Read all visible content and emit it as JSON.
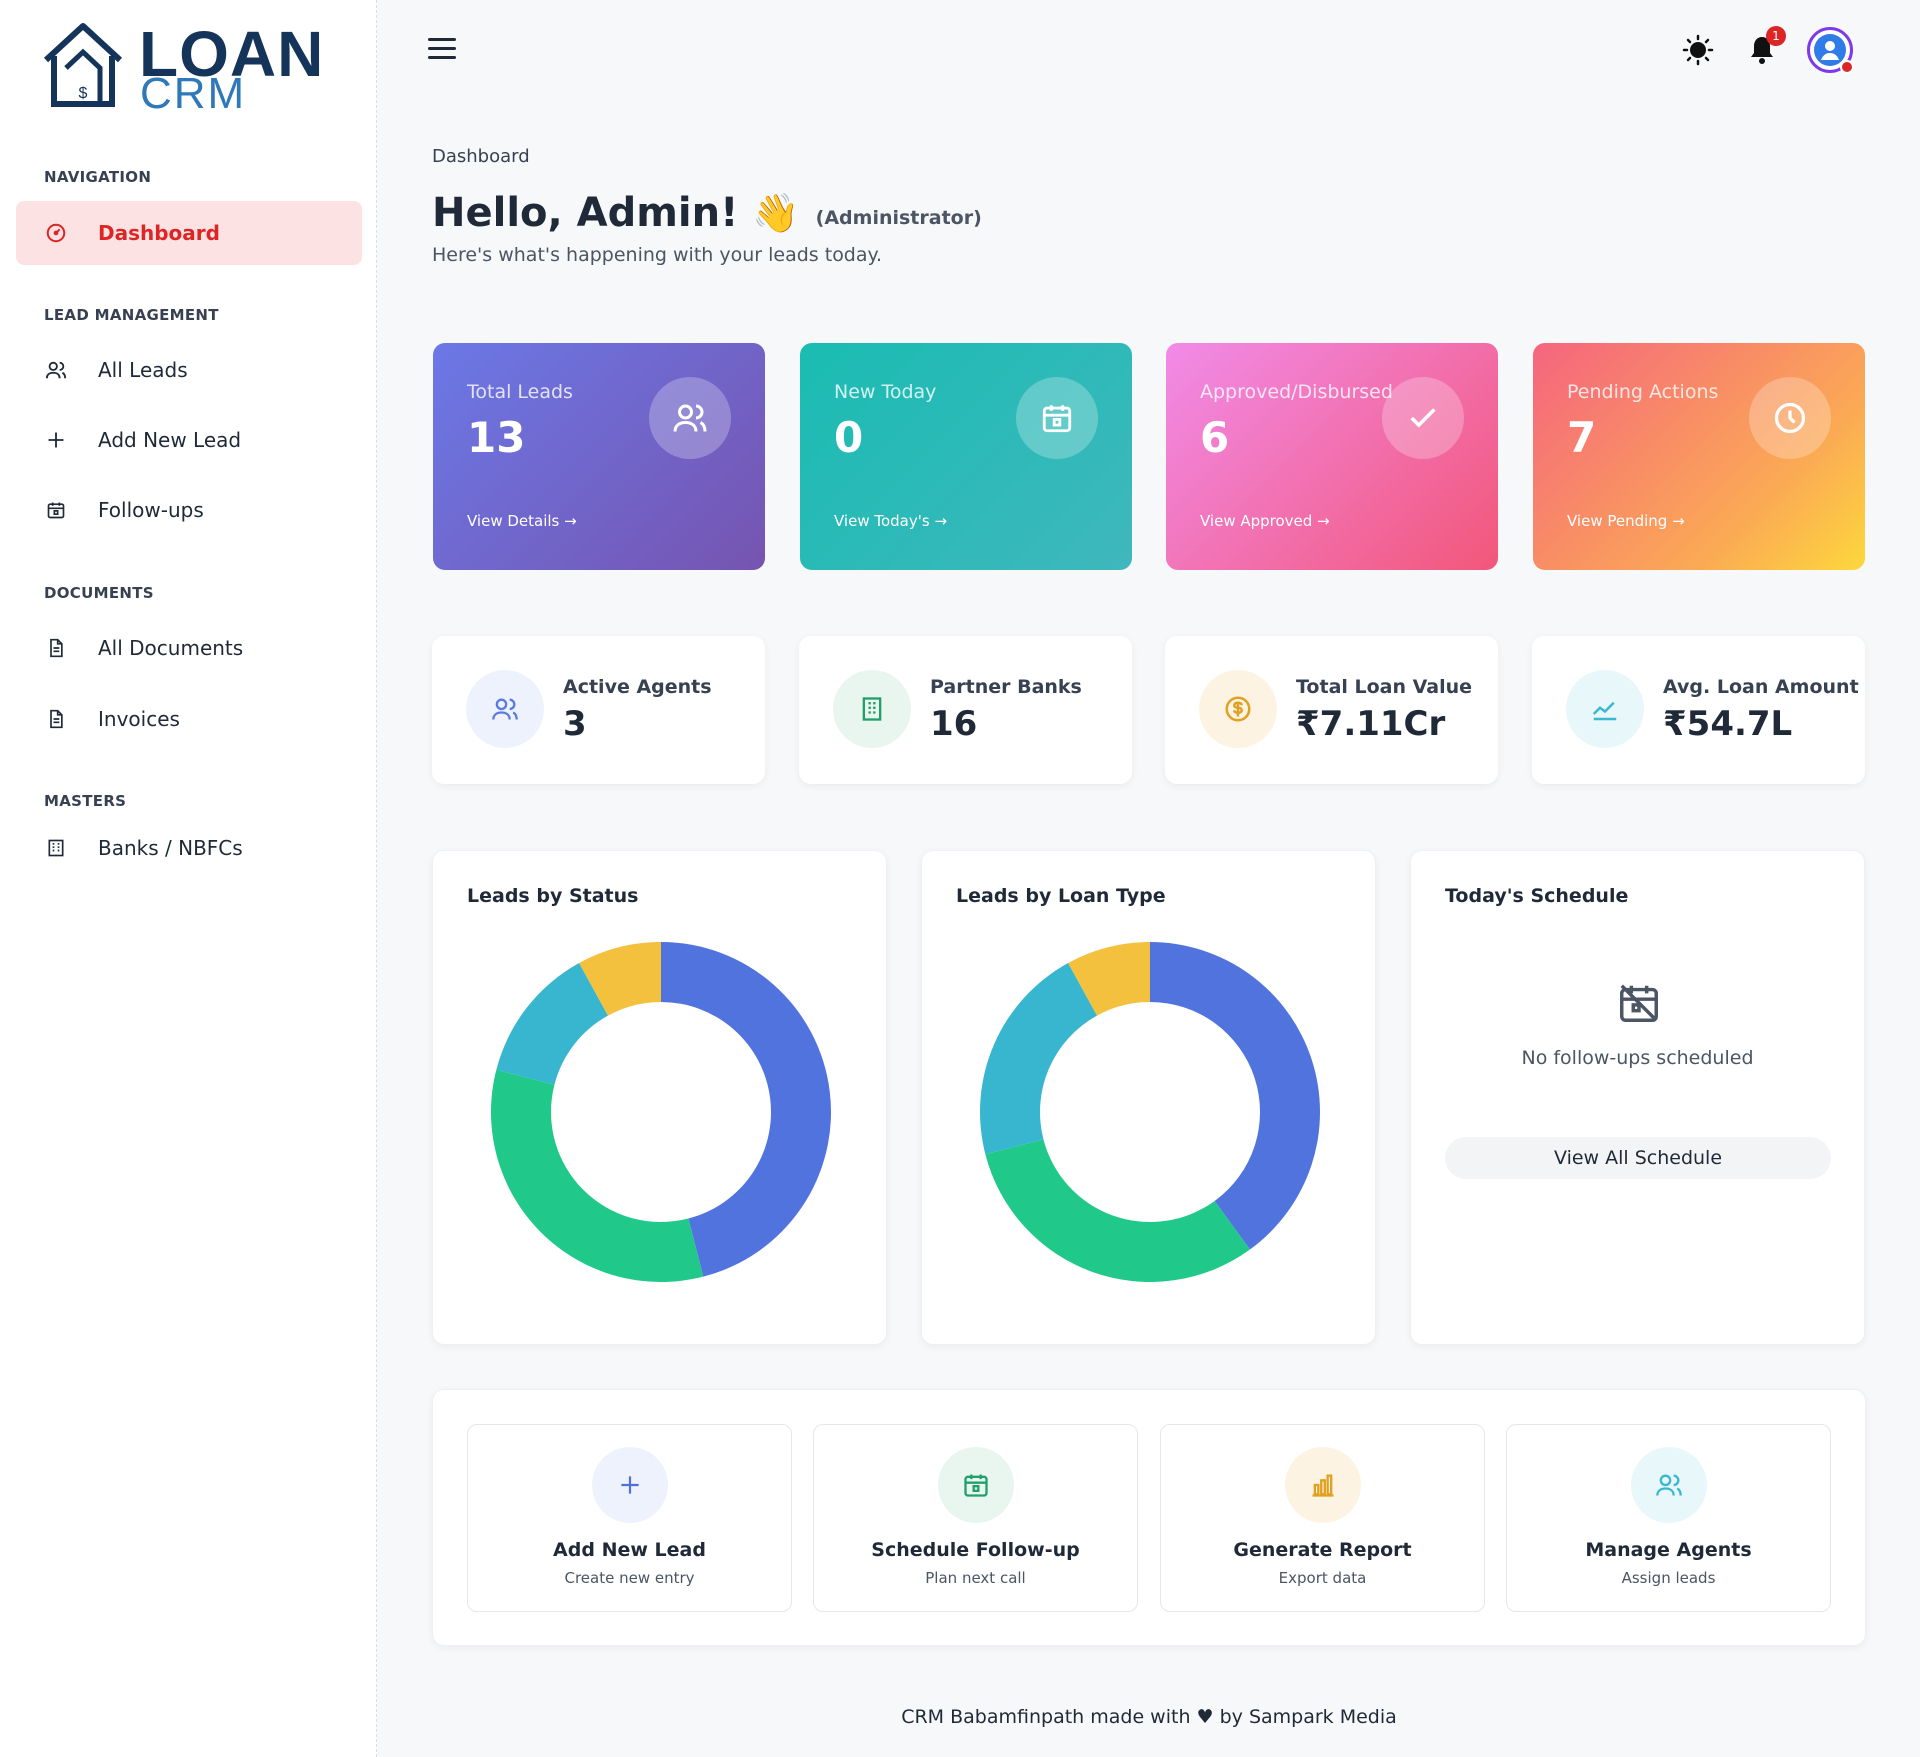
{
  "brand": {
    "word": "LOAN",
    "sub": "CRM"
  },
  "sidebar": {
    "sections": [
      {
        "title": "NAVIGATION",
        "items": [
          {
            "label": "Dashboard",
            "icon": "dashboard-gauge-icon",
            "active": true
          }
        ]
      },
      {
        "title": "LEAD MANAGEMENT",
        "items": [
          {
            "label": "All Leads",
            "icon": "users-icon"
          },
          {
            "label": "Add New Lead",
            "icon": "plus-icon"
          },
          {
            "label": "Follow-ups",
            "icon": "calendar-icon"
          }
        ]
      },
      {
        "title": "DOCUMENTS",
        "items": [
          {
            "label": "All Documents",
            "icon": "document-icon"
          },
          {
            "label": "Invoices",
            "icon": "document-icon"
          }
        ]
      },
      {
        "title": "MASTERS",
        "items": [
          {
            "label": "Banks / NBFCs",
            "icon": "building-icon"
          }
        ]
      }
    ]
  },
  "topbar": {
    "notification_count": "1",
    "icons": [
      "menu-icon",
      "sun-icon",
      "bell-icon",
      "user-avatar-icon"
    ]
  },
  "page": {
    "breadcrumb": "Dashboard",
    "greeting": "Hello, Admin!",
    "wave": "👋",
    "role": "(Administrator)",
    "subtitle": "Here's what's happening with your leads today."
  },
  "kpi_cards": [
    {
      "title": "Total Leads",
      "value": "13",
      "link": "View Details →",
      "icon": "users-icon"
    },
    {
      "title": "New Today",
      "value": "0",
      "link": "View Today's →",
      "icon": "calendar-icon"
    },
    {
      "title": "Approved/Disbursed",
      "value": "6",
      "link": "View Approved →",
      "icon": "check-icon"
    },
    {
      "title": "Pending Actions",
      "value": "7",
      "link": "View Pending →",
      "icon": "clock-icon"
    }
  ],
  "stats": [
    {
      "title": "Active Agents",
      "value": "3",
      "icon": "users-icon",
      "color": "#5b7be0",
      "bg": "#eef2fd"
    },
    {
      "title": "Partner Banks",
      "value": "16",
      "icon": "building-icon",
      "color": "#22a06b",
      "bg": "#e8f6ef"
    },
    {
      "title": "Total Loan Value",
      "value": "₹7.11Cr",
      "icon": "rupee-coin-icon",
      "color": "#e0a020",
      "bg": "#fdf3e3"
    },
    {
      "title": "Avg. Loan Amount",
      "value": "₹54.7L",
      "icon": "trend-line-icon",
      "color": "#3ab8cf",
      "bg": "#e8f7fa"
    }
  ],
  "chart_data": [
    {
      "type": "pie",
      "title": "Leads by Status",
      "donut": true,
      "values": [
        46,
        33,
        13,
        8
      ],
      "colors": [
        "#5173de",
        "#20c98a",
        "#38b6cf",
        "#f4c13e"
      ]
    },
    {
      "type": "pie",
      "title": "Leads by Loan Type",
      "donut": true,
      "values": [
        40,
        31,
        21,
        8
      ],
      "colors": [
        "#5173de",
        "#20c98a",
        "#38b6cf",
        "#f4c13e"
      ]
    }
  ],
  "schedule": {
    "title": "Today's Schedule",
    "empty_text": "No follow-ups scheduled",
    "button": "View All Schedule"
  },
  "quick_actions": [
    {
      "title": "Add New Lead",
      "sub": "Create new entry",
      "icon": "plus-icon",
      "color": "#4f6fd9",
      "bg": "#eef2fd"
    },
    {
      "title": "Schedule Follow-up",
      "sub": "Plan next call",
      "icon": "calendar-icon",
      "color": "#22a06b",
      "bg": "#e8f6ef"
    },
    {
      "title": "Generate Report",
      "sub": "Export data",
      "icon": "bar-chart-icon",
      "color": "#e0a020",
      "bg": "#fdf3e3"
    },
    {
      "title": "Manage Agents",
      "sub": "Assign leads",
      "icon": "users-icon",
      "color": "#3ab8cf",
      "bg": "#e8f7fa"
    }
  ],
  "footer": {
    "text": "CRM Babamfinpath made with ♥ by Sampark Media"
  }
}
